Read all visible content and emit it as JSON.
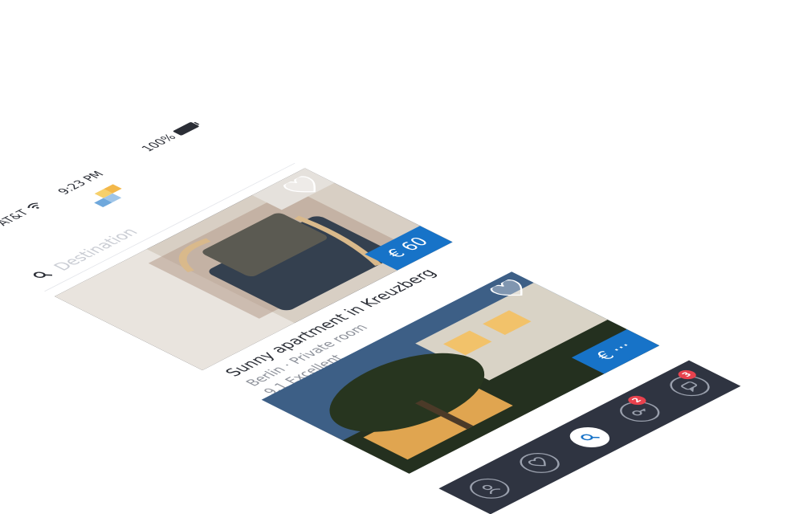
{
  "status_bar": {
    "carrier": "AT&T",
    "time": "9:23 PM",
    "battery": "100%"
  },
  "search": {
    "placeholder": "Destination"
  },
  "listings": [
    {
      "title": "Sunny apartment in Kreuzberg",
      "subtitle": "Berlin · Private room",
      "rating": "9.1 Excellent",
      "price": "€ 60"
    },
    {
      "price": "€ ···"
    }
  ],
  "tabbar": {
    "badges": {
      "keys": "2",
      "messages": "3"
    }
  },
  "colors": {
    "accent": "#1773c8",
    "tabbar": "#2f3441",
    "badge": "#e8424e"
  },
  "icons": {
    "search": "search-icon",
    "wifi": "wifi-icon",
    "heart": "heart-icon",
    "key": "key-icon",
    "chat": "chat-icon",
    "profile": "profile-icon"
  }
}
